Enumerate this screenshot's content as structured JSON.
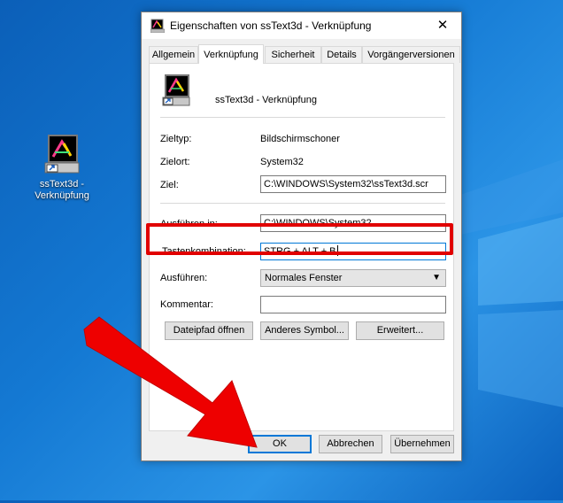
{
  "desktop": {
    "icon_label_line1": "ssText3d -",
    "icon_label_line2": "Verknüpfung"
  },
  "dialog": {
    "title": "Eigenschaften von ssText3d - Verknüpfung",
    "tabs": [
      {
        "label": "Allgemein"
      },
      {
        "label": "Verknüpfung",
        "active": true
      },
      {
        "label": "Sicherheit"
      },
      {
        "label": "Details"
      },
      {
        "label": "Vorgängerversionen"
      }
    ],
    "shortcut_name": "ssText3d - Verknüpfung",
    "fields": {
      "zieltyp_label": "Zieltyp:",
      "zieltyp_value": "Bildschirmschoner",
      "zielort_label": "Zielort:",
      "zielort_value": "System32",
      "ziel_label": "Ziel:",
      "ziel_value": "C:\\WINDOWS\\System32\\ssText3d.scr",
      "ausfuehren_in_label": "Ausführen in:",
      "ausfuehren_in_value": "C:\\WINDOWS\\System32",
      "tastenkombination_label": "Tastenkombination:",
      "tastenkombination_value": "STRG + ALT + B",
      "ausfuehren_label": "Ausführen:",
      "ausfuehren_value": "Normales Fenster",
      "kommentar_label": "Kommentar:",
      "kommentar_value": ""
    },
    "panel_buttons": {
      "open_path": "Dateipfad öffnen",
      "change_icon": "Anderes Symbol...",
      "advanced": "Erweitert..."
    },
    "footer_buttons": {
      "ok": "OK",
      "cancel": "Abbrechen",
      "apply": "Übernehmen"
    }
  },
  "colors": {
    "highlight": "#e10000",
    "arrow": "#ee0000",
    "accent": "#0078d7"
  }
}
